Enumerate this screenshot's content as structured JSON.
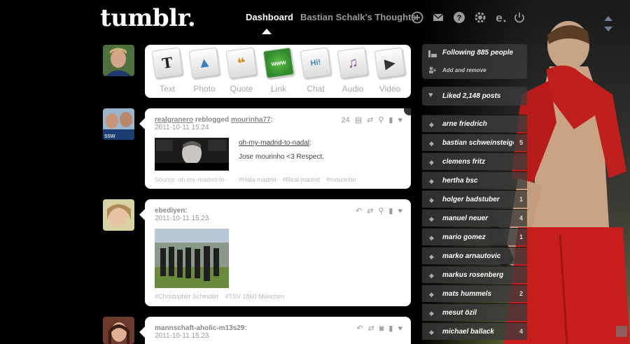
{
  "header": {
    "logo": "tumblr.",
    "nav": {
      "dashboard": "Dashboard",
      "blog": "Bastian Schalk's Thoughts"
    },
    "icons": [
      "plus-icon",
      "mail-icon",
      "help-icon",
      "gear-icon",
      "e-icon",
      "power-icon"
    ]
  },
  "post_types": [
    {
      "label": "Text",
      "glyph": "T",
      "color": "#222222"
    },
    {
      "label": "Photo",
      "glyph": "▲",
      "color": "#3a7ec2"
    },
    {
      "label": "Quote",
      "glyph": "❝",
      "color": "#e08c26"
    },
    {
      "label": "Link",
      "glyph": "www",
      "color": "#3b9a3b"
    },
    {
      "label": "Chat",
      "glyph": "Hi!",
      "color": "#3d86c7"
    },
    {
      "label": "Audio",
      "glyph": "♫",
      "color": "#8b4fa8"
    },
    {
      "label": "Video",
      "glyph": "▶",
      "color": "#333333"
    }
  ],
  "posts": [
    {
      "author": "realgranero",
      "action": "reblogged",
      "source": "mourinha77",
      "date": "2011-10-11 15.24",
      "note_count": "24",
      "link_text": "oh-my-madrid-to-nadal",
      "body": "Jose mourinho <3 Respect.",
      "source_line": "Source: oh-my-madrid-to-",
      "tags": [
        "#Hala madrid",
        "#Real madrid",
        "#mourinho"
      ]
    },
    {
      "author": "ebediyen",
      "date": "2011-10-11 15.23",
      "tags": [
        "#Christopher Schindler",
        "#TSV 1860 München"
      ]
    },
    {
      "author": "mannschaft-aholic-m13s29",
      "date": "2011-10-11 15.23"
    }
  ],
  "sidebar": {
    "following": "Following 885 people",
    "add_remove": "Add and remove",
    "liked": "Liked 2,148 posts",
    "tags": [
      {
        "label": "arne friedrich",
        "count": ""
      },
      {
        "label": "bastian schweinsteiger",
        "count": "5"
      },
      {
        "label": "clemens fritz",
        "count": ""
      },
      {
        "label": "hertha bsc",
        "count": ""
      },
      {
        "label": "holger badstuber",
        "count": "1"
      },
      {
        "label": "manuel neuer",
        "count": "4"
      },
      {
        "label": "mario gomez",
        "count": "1"
      },
      {
        "label": "marko arnautovic",
        "count": ""
      },
      {
        "label": "markus rosenberg",
        "count": ""
      },
      {
        "label": "mats hummels",
        "count": "2"
      },
      {
        "label": "mesut özil",
        "count": ""
      },
      {
        "label": "michael ballack",
        "count": "4"
      }
    ]
  }
}
